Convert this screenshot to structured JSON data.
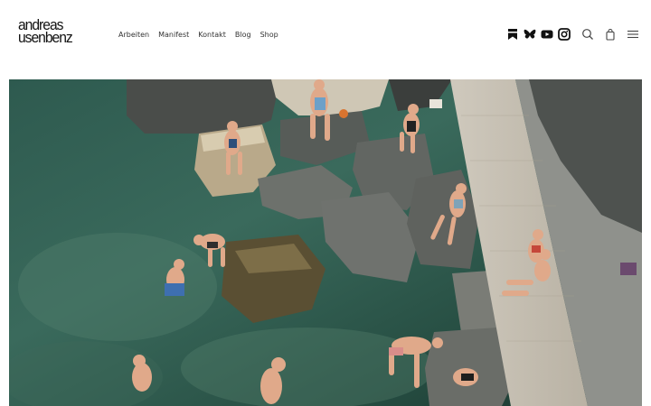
{
  "brand": {
    "logo_line1": "andreas",
    "logo_line2": "usenbenz"
  },
  "nav": {
    "items": [
      {
        "label": "Arbeiten"
      },
      {
        "label": "Manifest"
      },
      {
        "label": "Kontakt"
      },
      {
        "label": "Blog"
      },
      {
        "label": "Shop"
      }
    ]
  },
  "icons": [
    "bookmark-icon",
    "bluesky-butterfly-icon",
    "youtube-icon",
    "instagram-icon",
    "search-icon",
    "shopping-bag-icon",
    "hamburger-menu-icon"
  ],
  "colors": {
    "text": "#111111",
    "nav_text": "#333333",
    "background": "#ffffff"
  }
}
